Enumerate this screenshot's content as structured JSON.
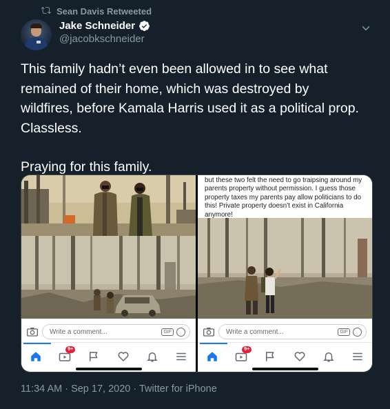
{
  "retweet": {
    "label": "Sean Davis Retweeted"
  },
  "tweet": {
    "author": {
      "display_name": "Jake Schneider",
      "handle": "@jacobkschneider",
      "verified": true
    },
    "text_paragraph_1": "This family hadn’t even been allowed in to see what\nremained of their home, which was destroyed by\nwildfires, before Kamala Harris used it as a political prop.\nClassless.",
    "text_paragraph_2": "Praying for this family.",
    "timestamp": "11:34 AM · Sep 17, 2020",
    "source": "Twitter for iPhone",
    "footer": "11:34 AM · Sep 17, 2020 · Twitter for iPhone"
  },
  "media": {
    "left_panel": {
      "composer_placeholder": "Write a comment...",
      "gif_label": "GIF",
      "badge_count": "9+"
    },
    "right_panel": {
      "caption_text": "but these two felt the need to go traipsing around my\nparents property without permission. I guess those\nproperty taxes my parents pay allow politicians to do\nthis! Private property doesn't exist in California anymore!",
      "composer_placeholder": "Write a comment...",
      "gif_label": "GIF",
      "badge_count": "9+"
    }
  },
  "colors": {
    "background": "#15202b",
    "secondary_text": "#8899a6",
    "verified_blue": "#1da1f2",
    "facebook_blue": "#1877f2",
    "badge_red": "#e41e3f"
  },
  "icons": [
    "retweet-icon",
    "verified-icon",
    "chevron-down-icon",
    "camera-icon",
    "emoji-icon",
    "home-icon",
    "video-icon",
    "flag-icon",
    "heart-icon",
    "bell-icon",
    "menu-icon"
  ]
}
